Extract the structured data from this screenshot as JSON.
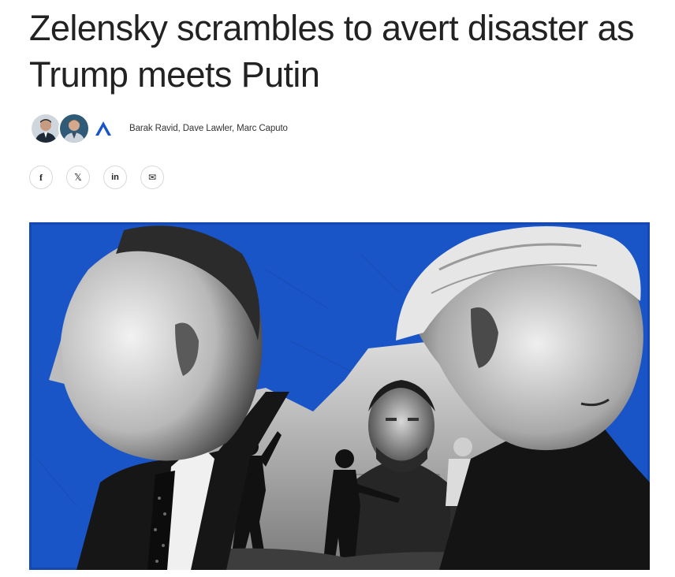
{
  "article": {
    "headline": "Zelensky scrambles to avert disaster as Trump meets Putin",
    "authors": "Barak Ravid, Dave Lawler, Marc Caputo"
  },
  "share": [
    {
      "label": "f",
      "icon": "facebook-icon"
    },
    {
      "label": "𝕏",
      "icon": "x-icon"
    },
    {
      "label": "in",
      "icon": "linkedin-icon"
    },
    {
      "label": "✉",
      "icon": "email-icon"
    }
  ],
  "colors": {
    "hero_background": "#1a55c7",
    "brand_mark": "#1a55c7",
    "text": "#222222"
  }
}
